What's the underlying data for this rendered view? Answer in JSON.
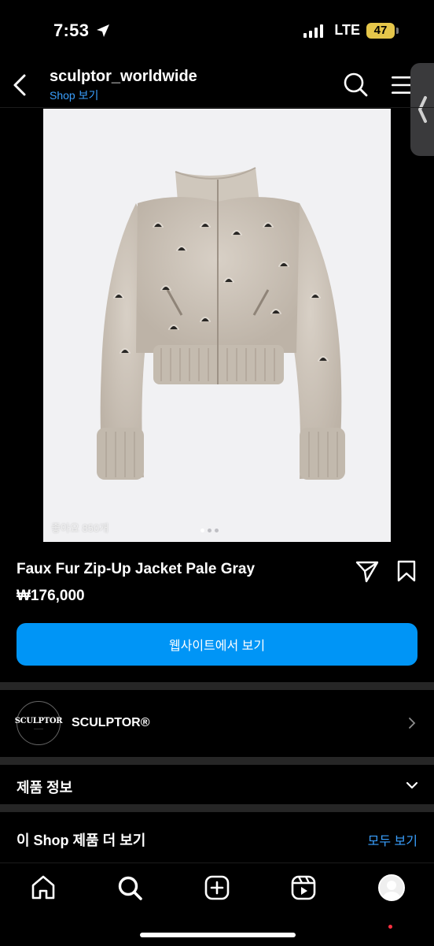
{
  "status_bar": {
    "time": "7:53",
    "network": "LTE",
    "battery": "47"
  },
  "header": {
    "account_name": "sculptor_worldwide",
    "shop_link": "Shop 보기"
  },
  "image": {
    "likes": "좋아요 850개",
    "page_count": 3,
    "current_page": 1
  },
  "product": {
    "title": "Faux Fur Zip-Up Jacket Pale Gray",
    "price": "₩176,000",
    "website_button": "웹사이트에서 보기"
  },
  "brand": {
    "logo_text": "SCULPTOR",
    "name": "SCULPTOR®"
  },
  "sections": {
    "product_info": "제품 정보",
    "more_from_shop": "이 Shop 제품 더 보기",
    "see_all": "모두 보기"
  },
  "colors": {
    "accent": "#0095f6",
    "link": "#3aa0ff",
    "battery": "#e5c64a"
  },
  "icons": {
    "back": "chevron-left-icon",
    "search": "search-icon",
    "menu": "hamburger-icon",
    "share": "send-icon",
    "save": "bookmark-icon",
    "home": "home-icon",
    "explore": "search-icon",
    "create": "plus-square-icon",
    "reels": "reels-icon"
  }
}
